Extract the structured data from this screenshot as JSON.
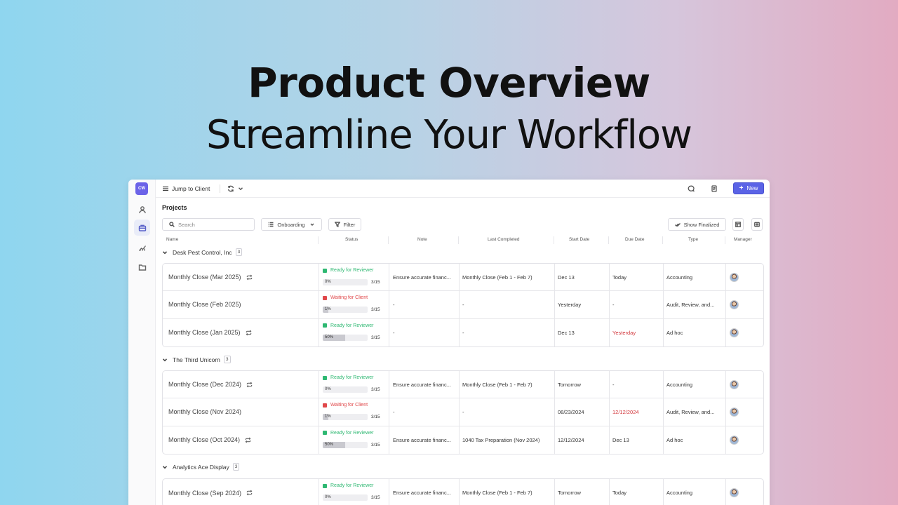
{
  "hero": {
    "title": "Product Overview",
    "subtitle": "Streamline Your Workflow"
  },
  "app": {
    "logo_text": "CW",
    "rail_icons": [
      "contacts-icon",
      "briefcase-icon",
      "chart-icon",
      "folder-icon"
    ],
    "topbar": {
      "jump_label": "Jump to Client",
      "new_label": "New"
    },
    "page_title": "Projects",
    "search_placeholder": "Search",
    "onboarding_label": "Onboarding",
    "filter_label": "Filter",
    "show_finalized_label": "Show Finalized",
    "columns": {
      "name": "Name",
      "status": "Status",
      "note": "Note",
      "last": "Last Completed",
      "start": "Start Date",
      "due": "Due Date",
      "type": "Type",
      "manager": "Manager"
    },
    "colors": {
      "accent": "#5a63e6",
      "ready": "#2eb872",
      "waiting": "#e0484a",
      "overdue": "#d2353a"
    },
    "groups": [
      {
        "name": "Desk Pest Control, Inc",
        "count": "3",
        "rows": [
          {
            "name": "Monthly Close (Mar 2025)",
            "recurring": true,
            "status": "Ready for Reviewer",
            "status_kind": "ready",
            "progress_label": "0%",
            "progress": 0,
            "steps": "3/15",
            "note": "Ensure accurate financ...",
            "last": "Monthly Close (Feb 1 - Feb 7)",
            "start": "Dec 13",
            "due": "Today",
            "due_red": false,
            "type": "Accounting"
          },
          {
            "name": "Monthly Close (Feb 2025)",
            "recurring": false,
            "status": "Waiting for Client",
            "status_kind": "waiting",
            "progress_label": "1%",
            "progress": 1,
            "steps": "3/15",
            "note": "-",
            "last": "-",
            "start": "Yesterday",
            "due": "-",
            "due_red": false,
            "type": "Audit, Review, and..."
          },
          {
            "name": "Monthly Close (Jan 2025)",
            "recurring": true,
            "status": "Ready for Reviewer",
            "status_kind": "ready",
            "progress_label": "50%",
            "progress": 50,
            "steps": "3/15",
            "note": "-",
            "last": "-",
            "start": "Dec 13",
            "due": "Yesterday",
            "due_red": true,
            "type": "Ad hoc"
          }
        ]
      },
      {
        "name": "The Third Unicorn",
        "count": "3",
        "rows": [
          {
            "name": "Monthly Close (Dec 2024)",
            "recurring": true,
            "status": "Ready for Reviewer",
            "status_kind": "ready",
            "progress_label": "0%",
            "progress": 0,
            "steps": "3/15",
            "note": "Ensure accurate financ...",
            "last": "Monthly Close (Feb 1 - Feb 7)",
            "start": "Tomorrow",
            "due": "-",
            "due_red": false,
            "type": "Accounting"
          },
          {
            "name": "Monthly Close (Nov 2024)",
            "recurring": false,
            "status": "Waiting for Client",
            "status_kind": "waiting",
            "progress_label": "1%",
            "progress": 1,
            "steps": "3/15",
            "note": "-",
            "last": "-",
            "start": "08/23/2024",
            "due": "12/12/2024",
            "due_red": true,
            "type": "Audit, Review, and..."
          },
          {
            "name": "Monthly Close (Oct 2024)",
            "recurring": true,
            "status": "Ready for Reviewer",
            "status_kind": "ready",
            "progress_label": "50%",
            "progress": 50,
            "steps": "3/15",
            "note": "Ensure accurate financ...",
            "last": "1040 Tax Preparation (Nov 2024)",
            "start": "12/12/2024",
            "due": "Dec 13",
            "due_red": false,
            "type": "Ad hoc"
          }
        ]
      },
      {
        "name": "Analytics Ace Display",
        "count": "3",
        "rows": [
          {
            "name": "Monthly Close (Sep 2024)",
            "recurring": true,
            "status": "Ready for Reviewer",
            "status_kind": "ready",
            "progress_label": "0%",
            "progress": 0,
            "steps": "3/15",
            "note": "Ensure accurate financ...",
            "last": "Monthly Close (Feb 1 - Feb 7)",
            "start": "Tomorrow",
            "due": "Today",
            "due_red": false,
            "type": "Accounting"
          }
        ]
      }
    ]
  }
}
